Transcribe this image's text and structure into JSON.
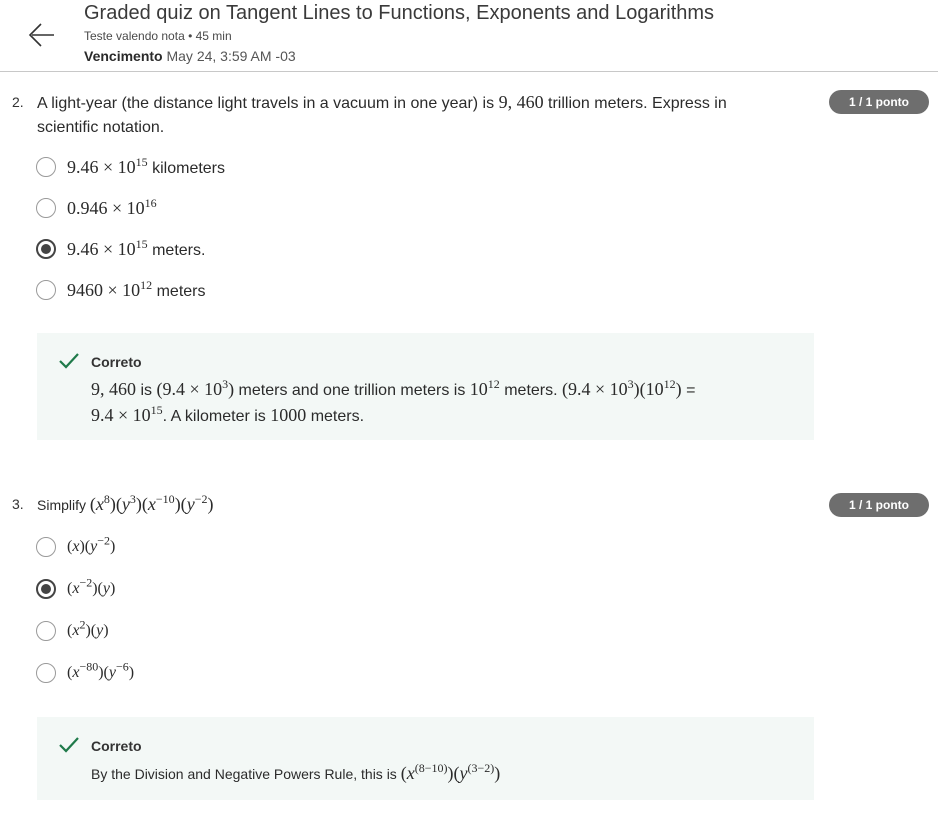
{
  "header": {
    "title": "Graded quiz on Tangent Lines to Functions, Exponents and Logarithms",
    "subtitle": "Teste valendo nota • 45 min",
    "due_label": "Vencimento",
    "due_value": "May 24, 3:59 AM -03",
    "back_icon": "arrow-left-icon"
  },
  "questions": [
    {
      "number": "2.",
      "text_before": "A light-year (the distance light travels in a vacuum in one year) is ",
      "text_math": "9, 460",
      "text_after": " trillion meters. Express in",
      "text_line2": "scientific notation.",
      "points": "1 / 1 ponto",
      "options": [
        {
          "base": "9.46 × 10",
          "exp": "15",
          "suffix": " kilometers",
          "selected": false
        },
        {
          "base": "0.946 × 10",
          "exp": "16",
          "suffix": "",
          "selected": false
        },
        {
          "base": "9.46 × 10",
          "exp": "15",
          "suffix": " meters.",
          "selected": true
        },
        {
          "base": "9460 × 10",
          "exp": "12",
          "suffix": " meters",
          "selected": false
        }
      ],
      "feedback": {
        "title": "Correto",
        "line1_a": "9, 460",
        "line1_b": " is ",
        "line1_c": "(9.4 × 10",
        "line1_c_exp": "3",
        "line1_d": ")",
        "line1_e": " meters and one trillion meters is ",
        "line1_f": "10",
        "line1_f_exp": "12",
        "line1_g": " meters. ",
        "line1_h": "(9.4 × 10",
        "line1_h_exp": "3",
        "line1_i": ")(10",
        "line1_i_exp": "12",
        "line1_j": ")",
        "line1_k": " =",
        "line2_a": "9.4 × 10",
        "line2_a_exp": "15",
        "line2_b": ". A kilometer is ",
        "line2_c": "1000",
        "line2_d": " meters."
      }
    },
    {
      "number": "3.",
      "text_before": "Simplify ",
      "points": "1 / 1 ponto",
      "feedback": {
        "title": "Correto",
        "text": "By the Division and Negative Powers Rule, this is "
      }
    }
  ],
  "colors": {
    "badge": "#6e6e6e",
    "check": "#1f7a4a",
    "feedback_bg": "#f3f8f6"
  }
}
